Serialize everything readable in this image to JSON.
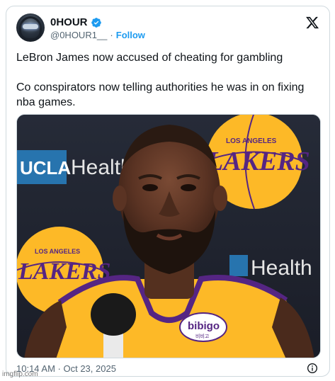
{
  "author": {
    "display_name": "0HOUR",
    "handle": "@0HOUR1__",
    "separator": "·",
    "follow_label": "Follow",
    "verified": true,
    "verified_color": "#1d9bf0"
  },
  "tweet": {
    "line1": "LeBron James now accused of cheating for gambling",
    "line2": "Co conspirators now telling authorities he was in on fixing nba games.",
    "timestamp": "10:14 AM · Oct 23, 2025"
  },
  "media": {
    "backdrop_text_ucla": "UCLA",
    "backdrop_text_health": "Health",
    "backdrop_text_lakers": "LAKERS",
    "backdrop_text_los_angeles": "LOS ANGELES",
    "jersey_patch": "bibigo",
    "jersey_patch_sub": "비비고",
    "colors": {
      "lakers_purple": "#552583",
      "lakers_gold": "#fdb927",
      "ucla_blue": "#2774ae"
    }
  },
  "icons": {
    "platform_logo": "x-logo-icon",
    "verified": "verified-badge-icon",
    "info": "info-icon"
  },
  "watermark": "imgflip.com"
}
